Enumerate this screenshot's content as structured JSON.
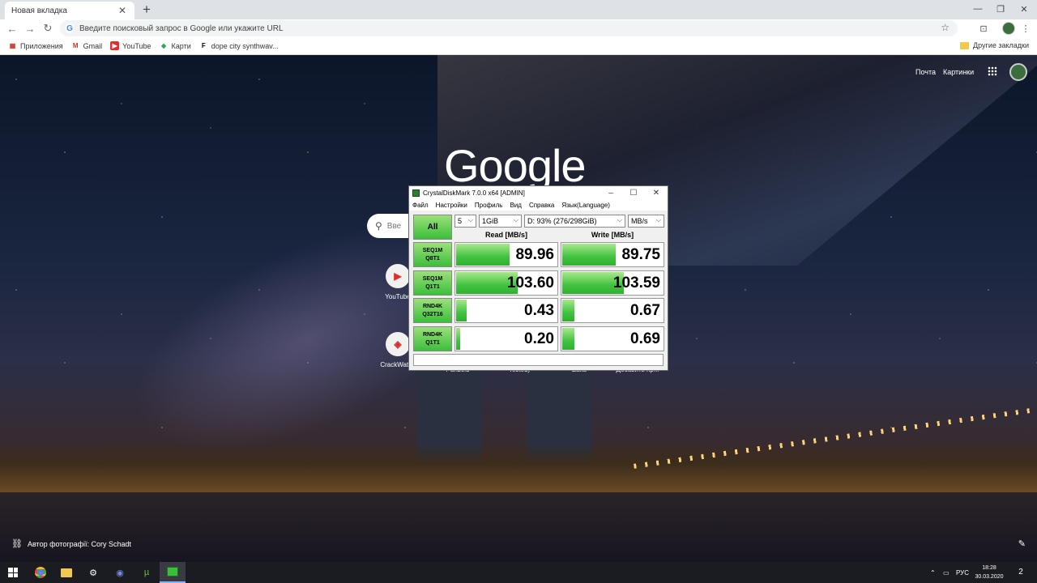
{
  "browser": {
    "tab_title": "Новая вкладка",
    "tab_close": "✕",
    "new_tab": "+",
    "omnibox_placeholder": "Введите поисковый запрос в Google или укажите URL",
    "bookmarks": [
      {
        "label": "Приложения",
        "icon": "apps-grid-icon"
      },
      {
        "label": "Gmail",
        "icon": "gmail-icon"
      },
      {
        "label": "YouTube",
        "icon": "youtube-icon"
      },
      {
        "label": "Карти",
        "icon": "maps-icon"
      },
      {
        "label": "dope city synthwav...",
        "icon": "bookmark-favicon-icon"
      }
    ],
    "other_bookmarks": "Другие закладки"
  },
  "ntp": {
    "link_mail": "Почта",
    "link_images": "Картинки",
    "logo": "Google",
    "search_placeholder": "Вве",
    "tiles": [
      {
        "label": "YouTube",
        "glyph": "▶",
        "color": "#e52d27"
      },
      {
        "label": "CrackWatch",
        "glyph": "◈",
        "color": "#d32f2f"
      },
      {
        "label": "Panzoid",
        "glyph": "",
        "color": "#444444"
      },
      {
        "label": "Tested)",
        "glyph": "",
        "color": "#444444"
      },
      {
        "label": "Zaka",
        "glyph": "",
        "color": "#444444"
      },
      {
        "label": "Добавить яр...",
        "glyph": "",
        "color": "#444444"
      }
    ],
    "photo_credit": "Автор фотографії: Cory Schadt"
  },
  "cdm": {
    "title": "CrystalDiskMark 7.0.0 x64 [ADMIN]",
    "menu": [
      "Файл",
      "Настройки",
      "Профиль",
      "Вид",
      "Справка",
      "Язык(Language)"
    ],
    "all_label": "All",
    "count": "5",
    "size": "1GiB",
    "drive": "D: 93% (276/298GiB)",
    "unit": "MB/s",
    "read_header": "Read [MB/s]",
    "write_header": "Write [MB/s]",
    "tests": [
      {
        "line1": "SEQ1M",
        "line2": "Q8T1",
        "read": "89.96",
        "write": "89.75",
        "read_fill": 0.52,
        "write_fill": 0.52
      },
      {
        "line1": "SEQ1M",
        "line2": "Q1T1",
        "read": "103.60",
        "write": "103.59",
        "read_fill": 0.6,
        "write_fill": 0.6
      },
      {
        "line1": "RND4K",
        "line2": "Q32T16",
        "read": "0.43",
        "write": "0.67",
        "read_fill": 0.1,
        "write_fill": 0.12
      },
      {
        "line1": "RND4K",
        "line2": "Q1T1",
        "read": "0.20",
        "write": "0.69",
        "read_fill": 0.04,
        "write_fill": 0.12
      }
    ]
  },
  "taskbar": {
    "lang": "РУС",
    "time": "18:28",
    "date": "30.03.2020",
    "notif_count": "2"
  }
}
